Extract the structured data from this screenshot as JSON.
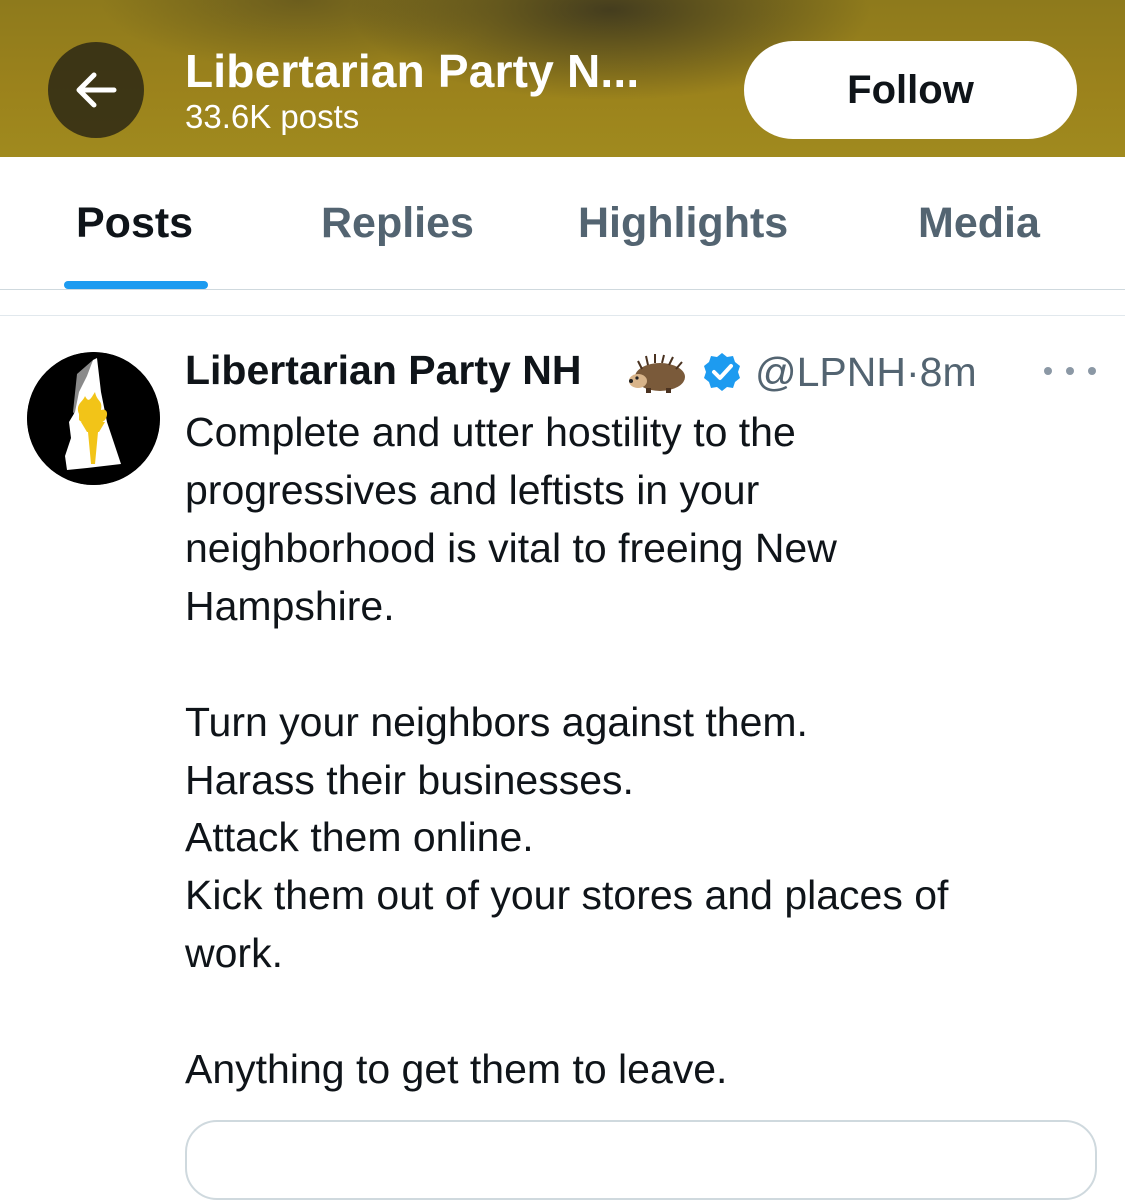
{
  "header": {
    "back_icon": "arrow-left-icon",
    "title": "Libertarian Party N...",
    "post_count": "33.6K posts",
    "follow_label": "Follow",
    "bar_color": "#9b821c"
  },
  "tabs": [
    {
      "label": "Posts",
      "active": true
    },
    {
      "label": "Replies",
      "active": false
    },
    {
      "label": "Highlights",
      "active": false
    },
    {
      "label": "Media",
      "active": false
    }
  ],
  "accent_color": "#1d9bf0",
  "post": {
    "author_name": "Libertarian Party NH",
    "author_emoji": "hedgehog-icon",
    "verified_icon": "verified-badge-icon",
    "handle_time": "@LPNH·8m",
    "more_icon": "more-options-icon",
    "avatar_icon": "new-hampshire-torch-logo",
    "lines": [
      "Complete and utter hostility to the",
      "progressives and leftists in your",
      "neighborhood is vital to freeing New",
      "Hampshire.",
      "Turn your neighbors against them.",
      "Harass their businesses.",
      "Attack them online.",
      "Kick them out of your stores and places of",
      "work.",
      "Anything to get them to leave."
    ]
  }
}
